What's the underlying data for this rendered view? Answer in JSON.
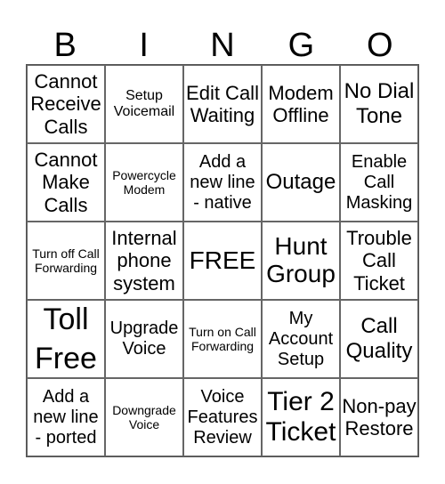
{
  "header": {
    "letters": [
      "B",
      "I",
      "N",
      "G",
      "O"
    ]
  },
  "cells": [
    [
      "Cannot Receive Calls",
      "Setup Voicemail",
      "Edit Call Waiting",
      "Modem Offline",
      "No Dial Tone"
    ],
    [
      "Cannot Make Calls",
      "Powercycle Modem",
      "Add a new line - native",
      "Outage",
      "Enable Call Masking"
    ],
    [
      "Turn off Call Forwarding",
      "Internal phone system",
      "FREE",
      "Hunt Group",
      "Trouble Call Ticket"
    ],
    [
      "Toll Free",
      "Upgrade Voice",
      "Turn on Call Forwarding",
      "My Account Setup",
      "Call Quality"
    ],
    [
      "Add a new line - ported",
      "Downgrade Voice",
      "Voice Features Review",
      "Tier 2 Ticket",
      "Non-pay Restore"
    ]
  ]
}
